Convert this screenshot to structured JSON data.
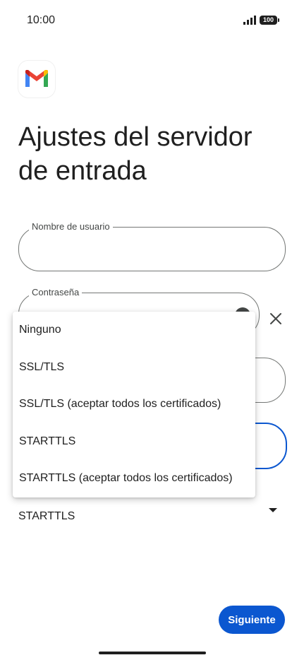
{
  "status_bar": {
    "time": "10:00",
    "battery": "100",
    "icons": [
      "signal-icon",
      "battery-icon"
    ]
  },
  "app": {
    "logo": "gmail-logo-icon"
  },
  "header": {
    "title": "Ajustes del servidor de entrada"
  },
  "form": {
    "username": {
      "label": "Nombre de usuario",
      "value": ""
    },
    "password": {
      "label": "Contraseña",
      "value": ""
    },
    "security": {
      "selected": "STARTTLS"
    }
  },
  "security_menu": {
    "options": [
      "Ninguno",
      "SSL/TLS",
      "SSL/TLS (aceptar todos los certificados)",
      "STARTTLS",
      "STARTTLS (aceptar todos los certificados)"
    ]
  },
  "actions": {
    "next_label": "Siguiente",
    "close_icon": "close-icon"
  },
  "colors": {
    "accent": "#0b57d0",
    "text": "#1f1f1f",
    "outline": "#747775",
    "background": "#ffffff"
  }
}
